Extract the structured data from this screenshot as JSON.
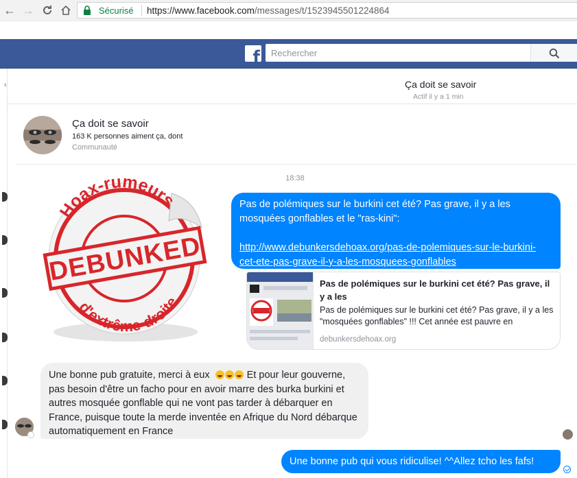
{
  "browser": {
    "secure_label": "Sécurisé",
    "url_host": "https://www.facebook.com",
    "url_path": "/messages/t/1523945501224864"
  },
  "facebook": {
    "logo_letter": "f",
    "search_placeholder": "Rechercher"
  },
  "conversation": {
    "title": "Ça doit se savoir",
    "status": "Actif il y a 1 min"
  },
  "page_card": {
    "name": "Ça doit se savoir",
    "likes": "163 K personnes aiment ça, dont",
    "category": "Communauté"
  },
  "timestamp": "18:38",
  "sticker": {
    "top_text": "Hoax-rumeurs",
    "stamp_text": "DEBUNKED",
    "bottom_text": "d'extrême-droite",
    "color": "#d7262b"
  },
  "messages": {
    "out1_text": "Pas de polémiques sur le burkini cet été? Pas grave, il y a les mosquées gonflables et le \"ras-kini\":",
    "out1_link": "http://www.debunkersdehoax.org/pas-de-polemiques-sur-le-burkini-cet-ete-pas-grave-il-y-a-les-mosquees-gonflables",
    "preview_title": "Pas de polémiques sur le burkini cet été? Pas grave, il y a les",
    "preview_desc": "Pas de polémiques sur le burkini cet été? Pas grave, il y a les \"mosquées gonflables\" !!! Cet année est pauvre en",
    "preview_domain": "debunkersdehoax.org",
    "in1_before_emoji": "Une bonne pub gratuite, merci à eux",
    "in1_after_emoji": "Et pour leur gouverne, pas besoin d'être un facho pour en avoir marre des burka burkini et autres mosquée gonflable qui ne vont pas tarder à débarquer en France, puisque toute la merde inventée en Afrique du Nord débarque automatiquement en France",
    "out2_text": "Une bonne pub qui vous ridiculise! ^^Allez tcho les fafs!"
  },
  "colors": {
    "facebook_blue": "#3b5998",
    "messenger_blue": "#0084ff",
    "incoming_bubble": "#f1f0f0"
  }
}
